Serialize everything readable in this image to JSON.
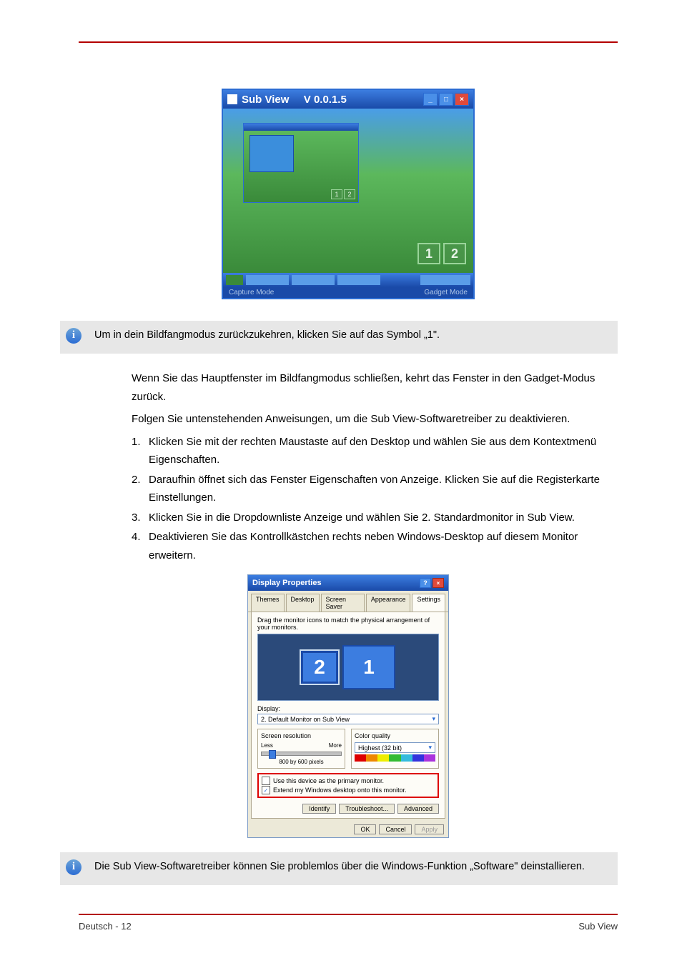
{
  "subview": {
    "title_app": "Sub View",
    "title_ver": "V 0.0.1.5",
    "badge1": "1",
    "badge2": "2",
    "footer_left": "Capture Mode",
    "footer_right": "Gadget Mode"
  },
  "info1": "Um in dein Bildfangmodus zurückzukehren, klicken Sie auf das Symbol „1\".",
  "para_intro": "Wenn Sie das Hauptfenster im Bildfangmodus schließen, kehrt das Fenster in den Gadget-Modus zurück.",
  "steps_lead": "Folgen Sie untenstehenden Anweisungen, um die Sub View-Softwaretreiber zu deaktivieren.",
  "steps": [
    {
      "n": "1.",
      "t_a": "Klicken Sie mit der rechten Maustaste auf den Desktop und wählen Sie aus dem Kontextmenü ",
      "b": "Eigenschaften",
      "t_b": "."
    },
    {
      "n": "2.",
      "t_a": "Daraufhin öffnet sich das Fenster ",
      "b": "Eigenschaften von Anzeige",
      "t_b": ". Klicken Sie auf die Registerkarte ",
      "b2": "Einstellungen",
      "t_c": "."
    },
    {
      "n": "3.",
      "t_a": "Klicken Sie in die Dropdownliste ",
      "b": "Anzeige",
      "t_b": " und wählen Sie ",
      "b2": "2. Standardmonitor in Sub View",
      "t_c": "."
    },
    {
      "n": "4.",
      "t_a": "Deaktivieren Sie das Kontrollkästchen rechts neben ",
      "b": "Windows-Desktop auf diesem Monitor erweitern",
      "t_b": "."
    }
  ],
  "dp": {
    "title": "Display Properties",
    "tabs": [
      "Themes",
      "Desktop",
      "Screen Saver",
      "Appearance",
      "Settings"
    ],
    "hint": "Drag the monitor icons to match the physical arrangement of your monitors.",
    "mon1": "1",
    "mon2": "2",
    "display_label": "Display:",
    "display_value": "2. Default Monitor on Sub View",
    "res_title": "Screen resolution",
    "less": "Less",
    "more": "More",
    "res_value": "800 by 600 pixels",
    "cq_title": "Color quality",
    "cq_value": "Highest (32 bit)",
    "chk1": "Use this device as the primary monitor.",
    "chk2": "Extend my Windows desktop onto this monitor.",
    "btns_mid": [
      "Identify",
      "Troubleshoot...",
      "Advanced"
    ],
    "btns_bot": [
      "OK",
      "Cancel",
      "Apply"
    ]
  },
  "info2": "Die Sub View-Softwaretreiber können Sie problemlos über die Windows-Funktion „Software\" deinstallieren.",
  "footer": {
    "left": "Deutsch - 12",
    "right": "Sub View"
  }
}
